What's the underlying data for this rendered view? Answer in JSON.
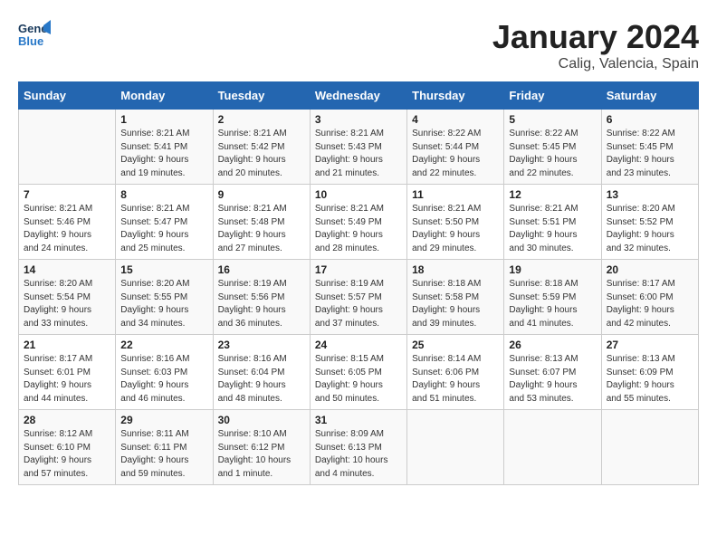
{
  "header": {
    "logo_line1": "General",
    "logo_line2": "Blue",
    "month": "January 2024",
    "location": "Calig, Valencia, Spain"
  },
  "weekdays": [
    "Sunday",
    "Monday",
    "Tuesday",
    "Wednesday",
    "Thursday",
    "Friday",
    "Saturday"
  ],
  "weeks": [
    [
      {
        "day": "",
        "info": ""
      },
      {
        "day": "1",
        "info": "Sunrise: 8:21 AM\nSunset: 5:41 PM\nDaylight: 9 hours\nand 19 minutes."
      },
      {
        "day": "2",
        "info": "Sunrise: 8:21 AM\nSunset: 5:42 PM\nDaylight: 9 hours\nand 20 minutes."
      },
      {
        "day": "3",
        "info": "Sunrise: 8:21 AM\nSunset: 5:43 PM\nDaylight: 9 hours\nand 21 minutes."
      },
      {
        "day": "4",
        "info": "Sunrise: 8:22 AM\nSunset: 5:44 PM\nDaylight: 9 hours\nand 22 minutes."
      },
      {
        "day": "5",
        "info": "Sunrise: 8:22 AM\nSunset: 5:45 PM\nDaylight: 9 hours\nand 22 minutes."
      },
      {
        "day": "6",
        "info": "Sunrise: 8:22 AM\nSunset: 5:45 PM\nDaylight: 9 hours\nand 23 minutes."
      }
    ],
    [
      {
        "day": "7",
        "info": "Sunrise: 8:21 AM\nSunset: 5:46 PM\nDaylight: 9 hours\nand 24 minutes."
      },
      {
        "day": "8",
        "info": "Sunrise: 8:21 AM\nSunset: 5:47 PM\nDaylight: 9 hours\nand 25 minutes."
      },
      {
        "day": "9",
        "info": "Sunrise: 8:21 AM\nSunset: 5:48 PM\nDaylight: 9 hours\nand 27 minutes."
      },
      {
        "day": "10",
        "info": "Sunrise: 8:21 AM\nSunset: 5:49 PM\nDaylight: 9 hours\nand 28 minutes."
      },
      {
        "day": "11",
        "info": "Sunrise: 8:21 AM\nSunset: 5:50 PM\nDaylight: 9 hours\nand 29 minutes."
      },
      {
        "day": "12",
        "info": "Sunrise: 8:21 AM\nSunset: 5:51 PM\nDaylight: 9 hours\nand 30 minutes."
      },
      {
        "day": "13",
        "info": "Sunrise: 8:20 AM\nSunset: 5:52 PM\nDaylight: 9 hours\nand 32 minutes."
      }
    ],
    [
      {
        "day": "14",
        "info": "Sunrise: 8:20 AM\nSunset: 5:54 PM\nDaylight: 9 hours\nand 33 minutes."
      },
      {
        "day": "15",
        "info": "Sunrise: 8:20 AM\nSunset: 5:55 PM\nDaylight: 9 hours\nand 34 minutes."
      },
      {
        "day": "16",
        "info": "Sunrise: 8:19 AM\nSunset: 5:56 PM\nDaylight: 9 hours\nand 36 minutes."
      },
      {
        "day": "17",
        "info": "Sunrise: 8:19 AM\nSunset: 5:57 PM\nDaylight: 9 hours\nand 37 minutes."
      },
      {
        "day": "18",
        "info": "Sunrise: 8:18 AM\nSunset: 5:58 PM\nDaylight: 9 hours\nand 39 minutes."
      },
      {
        "day": "19",
        "info": "Sunrise: 8:18 AM\nSunset: 5:59 PM\nDaylight: 9 hours\nand 41 minutes."
      },
      {
        "day": "20",
        "info": "Sunrise: 8:17 AM\nSunset: 6:00 PM\nDaylight: 9 hours\nand 42 minutes."
      }
    ],
    [
      {
        "day": "21",
        "info": "Sunrise: 8:17 AM\nSunset: 6:01 PM\nDaylight: 9 hours\nand 44 minutes."
      },
      {
        "day": "22",
        "info": "Sunrise: 8:16 AM\nSunset: 6:03 PM\nDaylight: 9 hours\nand 46 minutes."
      },
      {
        "day": "23",
        "info": "Sunrise: 8:16 AM\nSunset: 6:04 PM\nDaylight: 9 hours\nand 48 minutes."
      },
      {
        "day": "24",
        "info": "Sunrise: 8:15 AM\nSunset: 6:05 PM\nDaylight: 9 hours\nand 50 minutes."
      },
      {
        "day": "25",
        "info": "Sunrise: 8:14 AM\nSunset: 6:06 PM\nDaylight: 9 hours\nand 51 minutes."
      },
      {
        "day": "26",
        "info": "Sunrise: 8:13 AM\nSunset: 6:07 PM\nDaylight: 9 hours\nand 53 minutes."
      },
      {
        "day": "27",
        "info": "Sunrise: 8:13 AM\nSunset: 6:09 PM\nDaylight: 9 hours\nand 55 minutes."
      }
    ],
    [
      {
        "day": "28",
        "info": "Sunrise: 8:12 AM\nSunset: 6:10 PM\nDaylight: 9 hours\nand 57 minutes."
      },
      {
        "day": "29",
        "info": "Sunrise: 8:11 AM\nSunset: 6:11 PM\nDaylight: 9 hours\nand 59 minutes."
      },
      {
        "day": "30",
        "info": "Sunrise: 8:10 AM\nSunset: 6:12 PM\nDaylight: 10 hours\nand 1 minute."
      },
      {
        "day": "31",
        "info": "Sunrise: 8:09 AM\nSunset: 6:13 PM\nDaylight: 10 hours\nand 4 minutes."
      },
      {
        "day": "",
        "info": ""
      },
      {
        "day": "",
        "info": ""
      },
      {
        "day": "",
        "info": ""
      }
    ]
  ]
}
